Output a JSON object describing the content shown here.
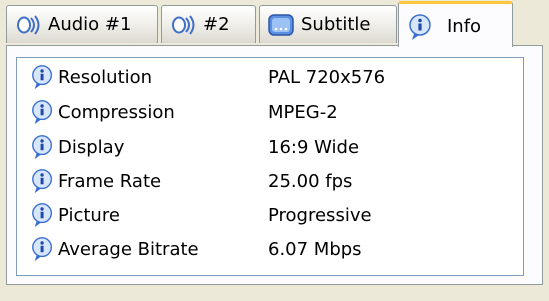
{
  "tabs": [
    {
      "label": "Audio #1",
      "icon": "speaker-sound-icon",
      "active": false
    },
    {
      "label": "#2",
      "icon": "speaker-sound-icon",
      "active": false
    },
    {
      "label": "Subtitle",
      "icon": "subtitle-icon",
      "active": false
    },
    {
      "label": "Info",
      "icon": "info-icon",
      "active": true
    }
  ],
  "info": {
    "rows": [
      {
        "key": "Resolution",
        "value": "PAL 720x576"
      },
      {
        "key": "Compression",
        "value": "MPEG-2"
      },
      {
        "key": "Display",
        "value": "16:9 Wide"
      },
      {
        "key": "Frame Rate",
        "value": "25.00 fps"
      },
      {
        "key": "Picture",
        "value": "Progressive"
      },
      {
        "key": "Average Bitrate",
        "value": "6.07 Mbps"
      }
    ]
  },
  "colors": {
    "tab_highlight": "#ffc83c",
    "info_icon_blue": "#3a6fcf",
    "panel_border": "#919b9c"
  }
}
